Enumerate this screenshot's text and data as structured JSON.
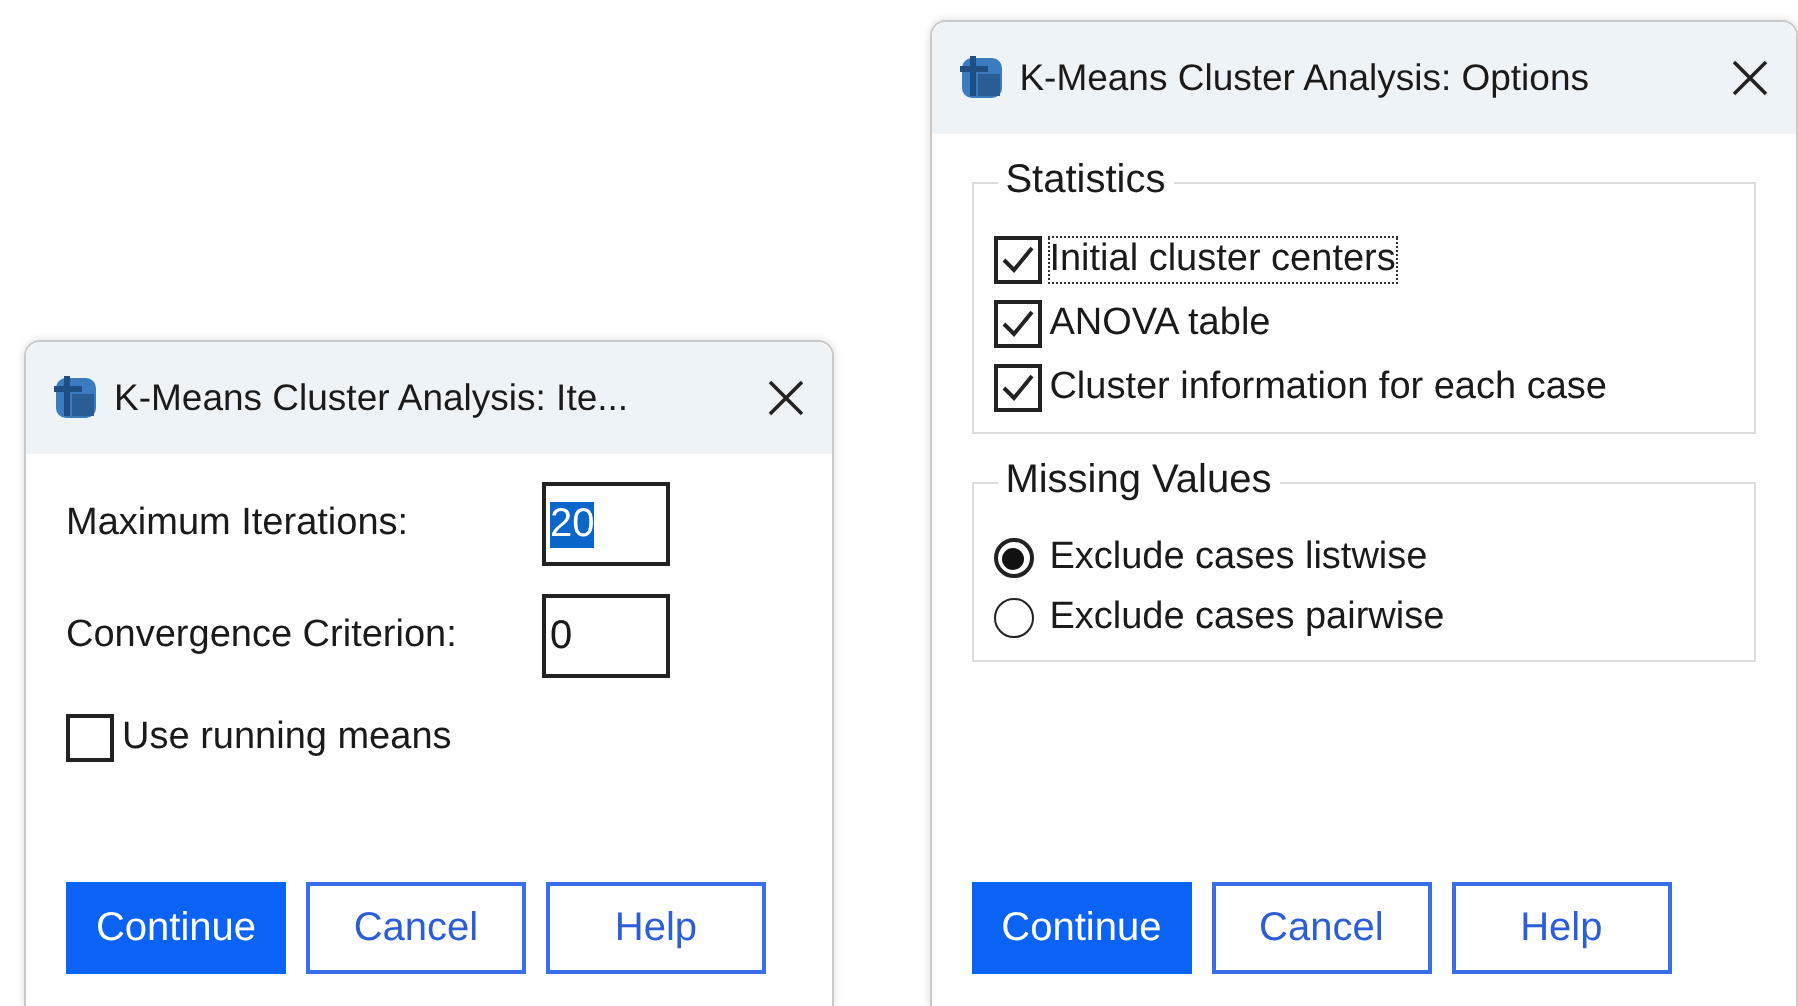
{
  "dialogs": [
    {
      "title": "K-Means Cluster Analysis: Ite...",
      "items": [
        {
          "kind": "field",
          "label": "Maximum Iterations:",
          "value": "20",
          "value_selected": true
        },
        {
          "kind": "field",
          "label": "Convergence Criterion:",
          "value": "0",
          "value_selected": false
        },
        {
          "kind": "checkbox",
          "label": "Use running means",
          "checked": false,
          "focused": false
        }
      ],
      "buttons": [
        {
          "label": "Continue",
          "default": true
        },
        {
          "label": "Cancel",
          "default": false
        },
        {
          "label": "Help",
          "default": false
        }
      ]
    },
    {
      "title": "K-Means Cluster Analysis: Options",
      "items": [
        {
          "kind": "group",
          "title": "Statistics",
          "items": [
            {
              "kind": "checkbox",
              "label": "Initial cluster centers",
              "checked": true,
              "focused": true
            },
            {
              "kind": "checkbox",
              "label": "ANOVA table",
              "checked": true,
              "focused": false
            },
            {
              "kind": "checkbox",
              "label": "Cluster information for each case",
              "checked": true,
              "focused": false
            }
          ]
        },
        {
          "kind": "group",
          "title": "Missing Values",
          "items": [
            {
              "kind": "radio",
              "label": "Exclude cases listwise",
              "selected": true
            },
            {
              "kind": "radio",
              "label": "Exclude cases pairwise",
              "selected": false
            }
          ]
        }
      ],
      "buttons": [
        {
          "label": "Continue",
          "default": true
        },
        {
          "label": "Cancel",
          "default": false
        },
        {
          "label": "Help",
          "default": false
        }
      ]
    }
  ]
}
